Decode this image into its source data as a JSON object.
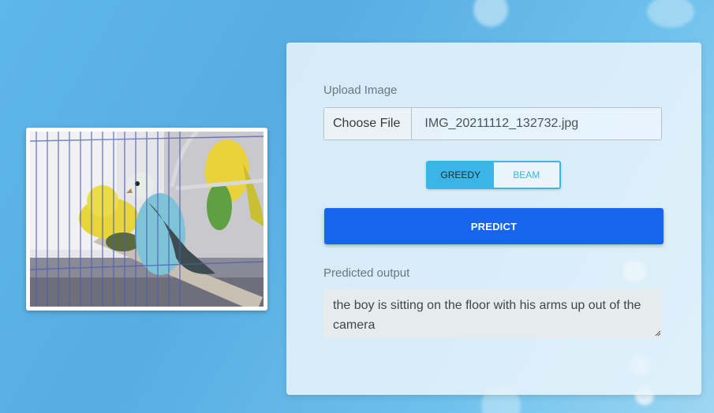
{
  "upload": {
    "label": "Upload Image",
    "choose_button": "Choose File",
    "file_name": "IMG_20211112_132732.jpg"
  },
  "decoding": {
    "options": [
      "GREEDY",
      "BEAM"
    ],
    "selected": "GREEDY"
  },
  "predict_button": "PREDICT",
  "output": {
    "label": "Predicted output",
    "text": "the boy is sitting on the floor with his arms up out of the camera"
  },
  "colors": {
    "primary": "#1565ef",
    "accent": "#3bb4e6",
    "background": "#5fb6e8"
  },
  "icons": {
    "preview": "uploaded-parakeets-photo",
    "resize": "textarea-resize-icon"
  }
}
